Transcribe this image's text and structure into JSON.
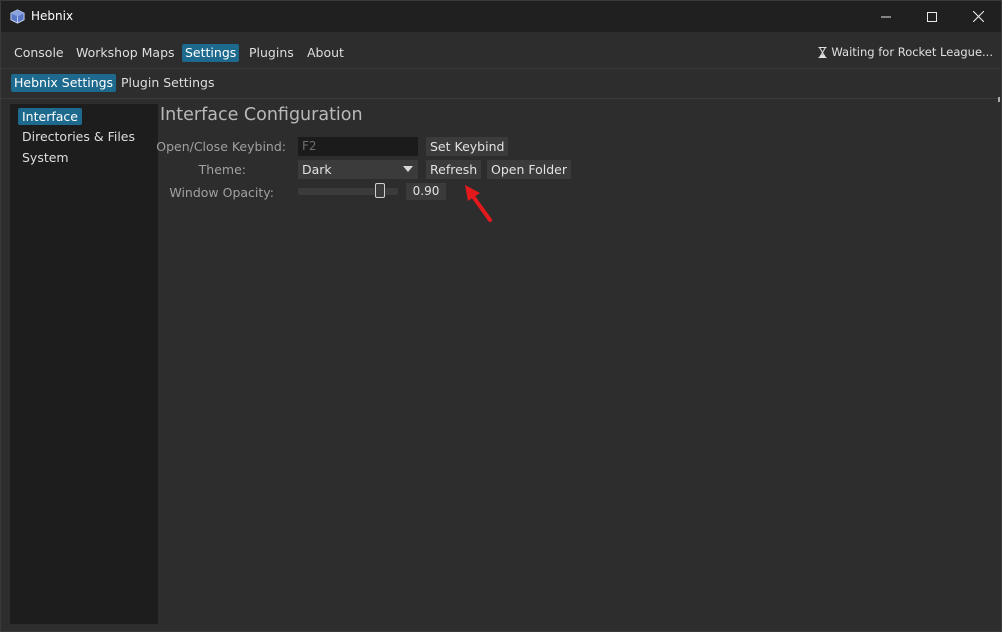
{
  "window": {
    "title": "Hebnix",
    "controls": {
      "minimize": "minimize-icon",
      "maximize": "maximize-icon",
      "close": "close-icon"
    }
  },
  "menu": {
    "items": [
      {
        "label": "Console"
      },
      {
        "label": "Workshop Maps"
      },
      {
        "label": "Settings",
        "active": true
      },
      {
        "label": "Plugins"
      },
      {
        "label": "About"
      }
    ],
    "status": "Waiting for Rocket League..."
  },
  "subtabs": [
    {
      "label": "Hebnix Settings",
      "active": true
    },
    {
      "label": "Plugin Settings"
    }
  ],
  "sidebar": {
    "items": [
      {
        "label": "Interface",
        "active": true
      },
      {
        "label": "Directories & Files"
      },
      {
        "label": "System"
      }
    ]
  },
  "main": {
    "title": "Interface Configuration",
    "keybind": {
      "label": "Open/Close Keybind:",
      "value": "F2",
      "button": "Set Keybind"
    },
    "theme": {
      "label": "Theme:",
      "selected": "Dark",
      "refresh": "Refresh",
      "open_folder": "Open Folder"
    },
    "opacity": {
      "label": "Window Opacity:",
      "value": "0.90",
      "slider_fraction": 0.9
    }
  },
  "colors": {
    "accent": "#1e6a8e",
    "background": "#2d2d2d",
    "sidebar": "#1d1d1d",
    "annotation": "#e3191c"
  }
}
